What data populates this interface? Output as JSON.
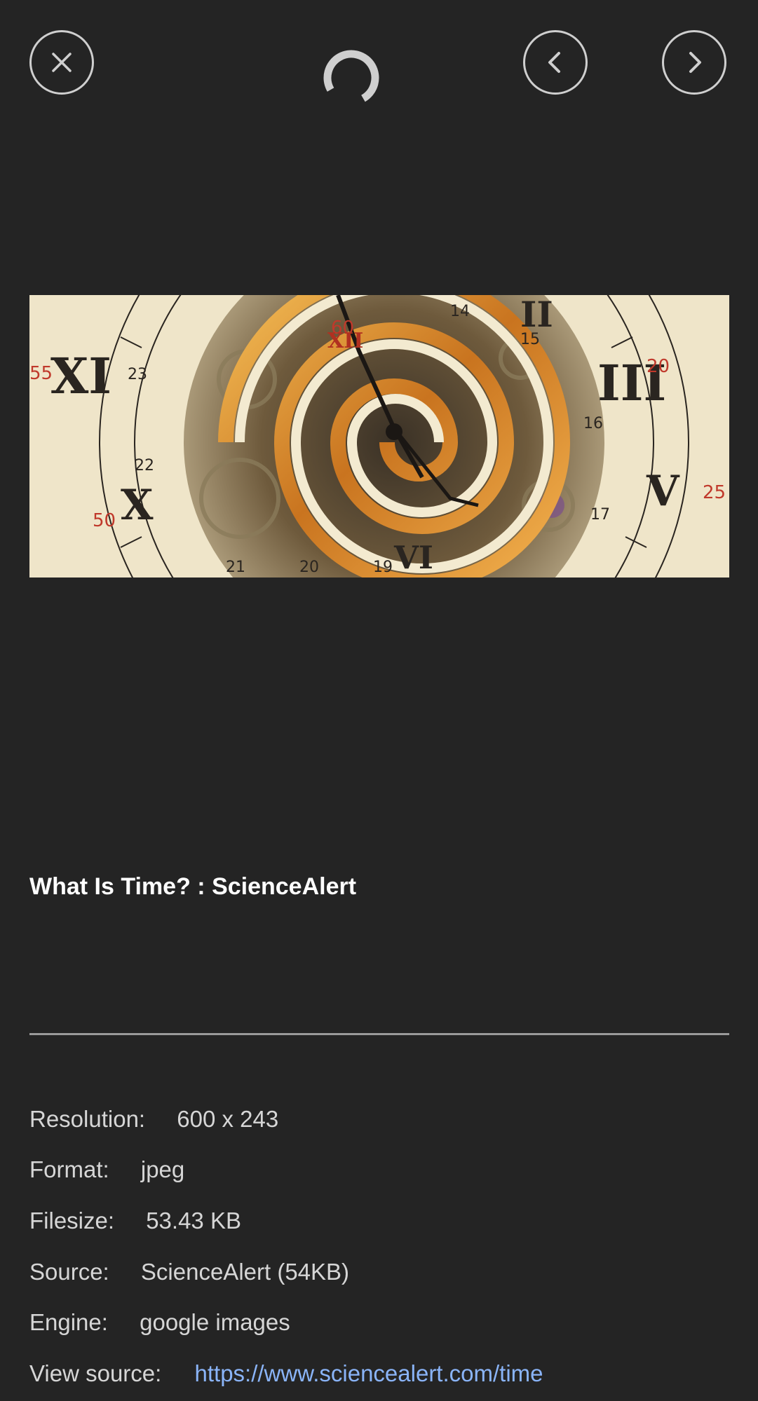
{
  "toolbar": {
    "close_icon": "close-icon",
    "prev_icon": "chevron-left-icon",
    "next_icon": "chevron-right-icon",
    "spinner_icon": "loading-spinner-icon"
  },
  "image": {
    "description_icon": "spiral-clock-image",
    "title": "What Is Time? : ScienceAlert"
  },
  "details": {
    "resolution_label": "Resolution:",
    "resolution_value": "600 x 243",
    "format_label": "Format:",
    "format_value": "jpeg",
    "filesize_label": "Filesize:",
    "filesize_value": "53.43 KB",
    "source_label": "Source:",
    "source_value": "ScienceAlert (54KB)",
    "engine_label": "Engine:",
    "engine_value": "google images",
    "view_source_label": "View source:",
    "view_source_value": "https://www.sciencealert.com/time"
  },
  "colors": {
    "background": "#242424",
    "link": "#8ab4f8",
    "button_border": "#cfcfcf"
  }
}
